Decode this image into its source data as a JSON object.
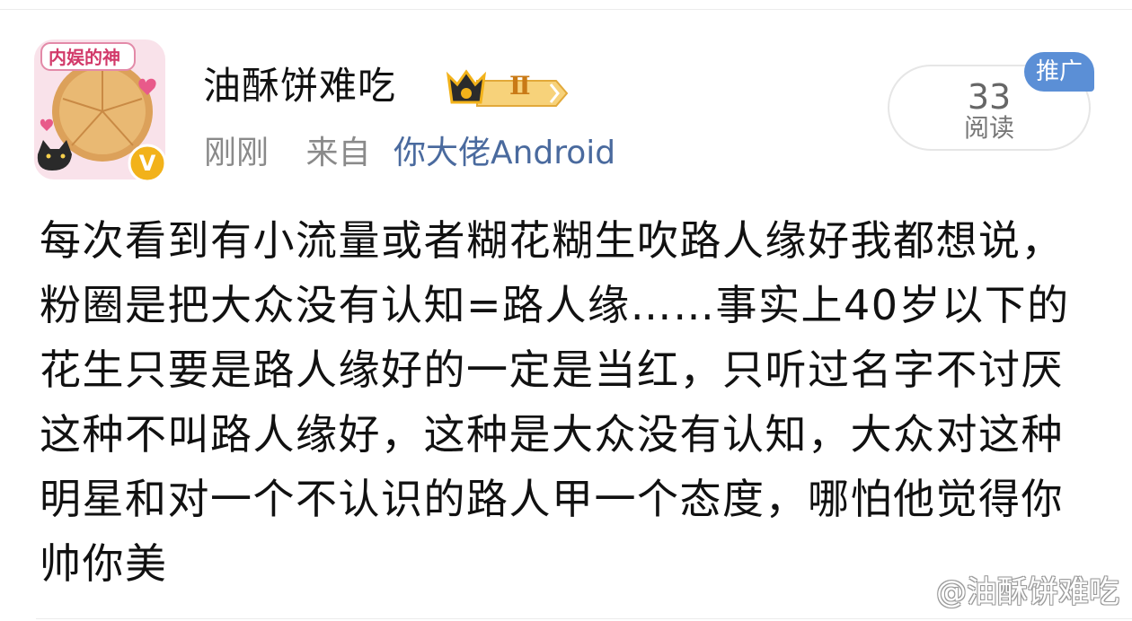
{
  "post": {
    "author": {
      "name": "油酥饼难吃",
      "avatar_frame_text": "内娱的神",
      "verified_mark": "V",
      "level_badge": "Ⅱ"
    },
    "time": "刚刚",
    "source_prefix": "来自",
    "source": "你大佬Android",
    "reads": {
      "count": "33",
      "label": "阅读"
    },
    "promo_tag": "推广",
    "content": "每次看到有小流量或者糊花糊生吹路人缘好我都想说，粉圈是把大众没有认知=路人缘……事实上40岁以下的花生只要是路人缘好的一定是当红，只听过名字不讨厌这种不叫路人缘好，这种是大众没有认知，大众对这种明星和对一个不认识的路人甲一个态度，哪怕他觉得你帅你美"
  },
  "watermark": "@油酥饼难吃",
  "colors": {
    "source_link": "#4a6a9e",
    "promo_bg": "#5b8fd6",
    "meta_gray": "#8a8a8a",
    "verified_gold": "#f2b21a"
  }
}
